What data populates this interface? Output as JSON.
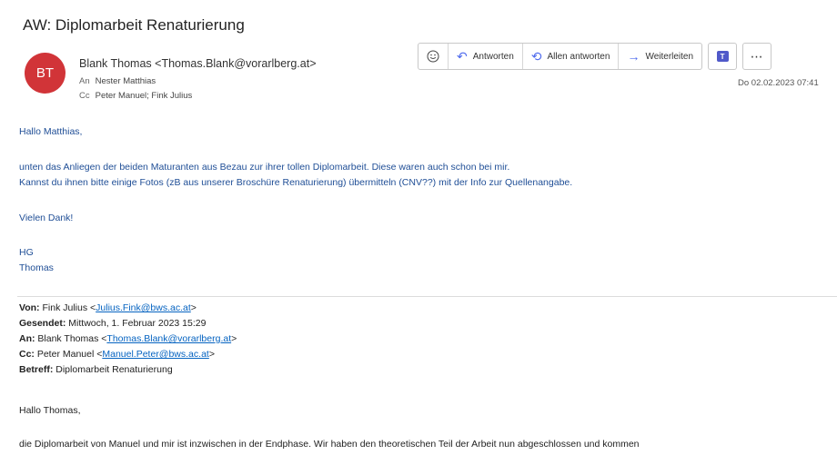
{
  "subject": "AW: Diplomarbeit Renaturierung",
  "avatar_initials": "BT",
  "avatar_color": "#d13438",
  "sender": "Blank Thomas <Thomas.Blank@vorarlberg.at>",
  "to_label": "An",
  "to_value": "Nester Matthias",
  "cc_label": "Cc",
  "cc_value": "Peter Manuel; Fink Julius",
  "toolbar": {
    "emoji_icon": "smiley-icon",
    "reply_label": "Antworten",
    "reply_all_label": "Allen antworten",
    "forward_label": "Weiterleiten",
    "teams_icon": "teams-icon",
    "more_icon": "more-icon"
  },
  "date": "Do 02.02.2023 07:41",
  "reply_body": {
    "greeting": "Hallo Matthias,",
    "line1": "unten das Anliegen der beiden Maturanten aus Bezau zur ihrer tollen Diplomarbeit. Diese waren auch schon bei mir.",
    "line2": "Kannst du ihnen bitte einige Fotos (zB aus unserer Broschüre Renaturierung) übermitteln (CNV??) mit der Info zur Quellenangabe.",
    "thanks": "Vielen Dank!",
    "sign1": "HG",
    "sign2": "Thomas"
  },
  "quoted_header": {
    "von_label": "Von:",
    "von_name": "Fink Julius <",
    "von_email": "Julius.Fink@bws.ac.at",
    "von_end": ">",
    "gesendet_label": "Gesendet:",
    "gesendet_value": "Mittwoch, 1. Februar 2023 15:29",
    "an_label": "An:",
    "an_name": "Blank Thomas <",
    "an_email": "Thomas.Blank@vorarlberg.at",
    "an_end": ">",
    "cc_label": "Cc:",
    "cc_name": "Peter Manuel <",
    "cc_email": "Manuel.Peter@bws.ac.at",
    "cc_end": ">",
    "betreff_label": "Betreff:",
    "betreff_value": "Diplomarbeit Renaturierung"
  },
  "quoted_body": {
    "greeting": "Hallo Thomas,",
    "line1": "die Diplomarbeit von Manuel und mir ist inzwischen in der Endphase. Wir haben den theoretischen Teil der Arbeit nun abgeschlossen und kommen"
  }
}
